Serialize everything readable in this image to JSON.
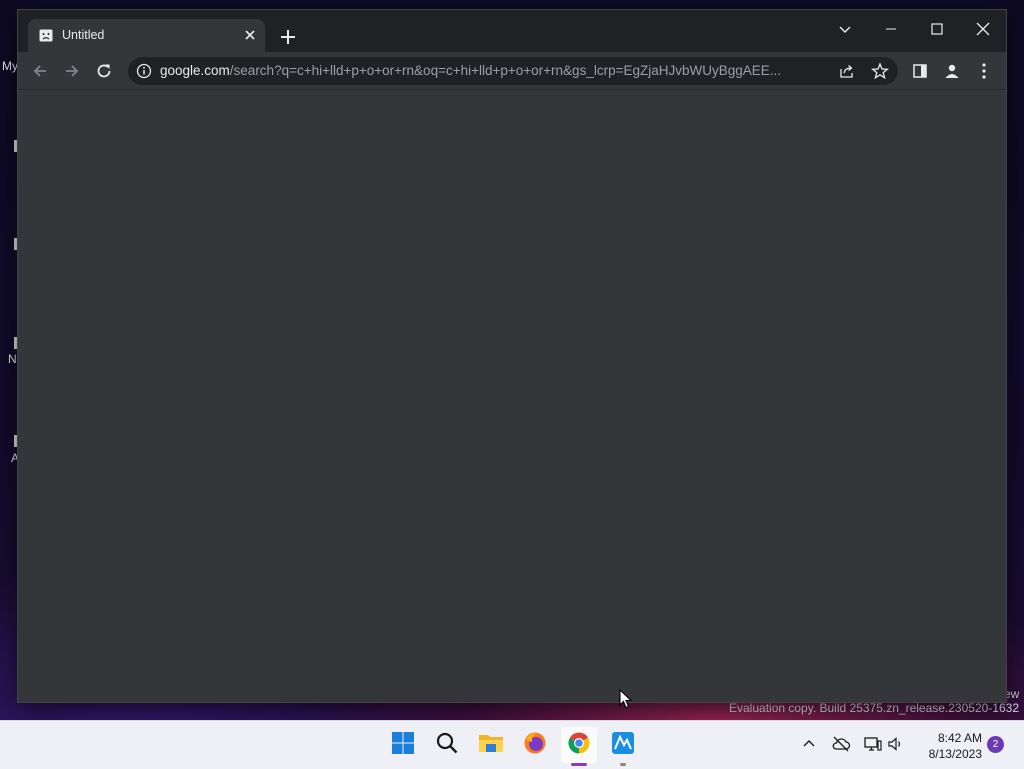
{
  "browser": {
    "tab": {
      "title": "Untitled",
      "favicon": "sad-page-icon"
    },
    "omnibox": {
      "host": "google.com",
      "path": "/search?q=c+hi+lld+p+o+or+rn&oq=c+hi+lld+p+o+or+rn&gs_lcrp=EgZjaHJvbWUyBggAEE..."
    },
    "icons": {
      "back": "arrow-left-icon",
      "forward": "arrow-right-icon",
      "reload": "reload-icon",
      "info": "info-icon",
      "share": "share-icon",
      "bookmark": "star-icon",
      "side_panel": "side-panel-icon",
      "profile": "profile-icon",
      "menu": "kebab-menu-icon"
    }
  },
  "desktop": {
    "fragments": [
      "My",
      "N",
      "A"
    ],
    "watermark": "Evaluation copy. Build 25375.zn_release.230520-1632",
    "watermark_fragment": "ew"
  },
  "taskbar": {
    "apps": [
      "start",
      "search",
      "file-explorer",
      "firefox",
      "chrome",
      "app"
    ],
    "clock": {
      "time": "8:42 AM",
      "date": "8/13/2023"
    },
    "notifications": "2"
  },
  "colors": {
    "tabstrip": "#202124",
    "toolbar": "#35363a",
    "omnibox": "#202124",
    "taskbar": "#eef0f5",
    "notification_badge": "#6a3ab8"
  }
}
